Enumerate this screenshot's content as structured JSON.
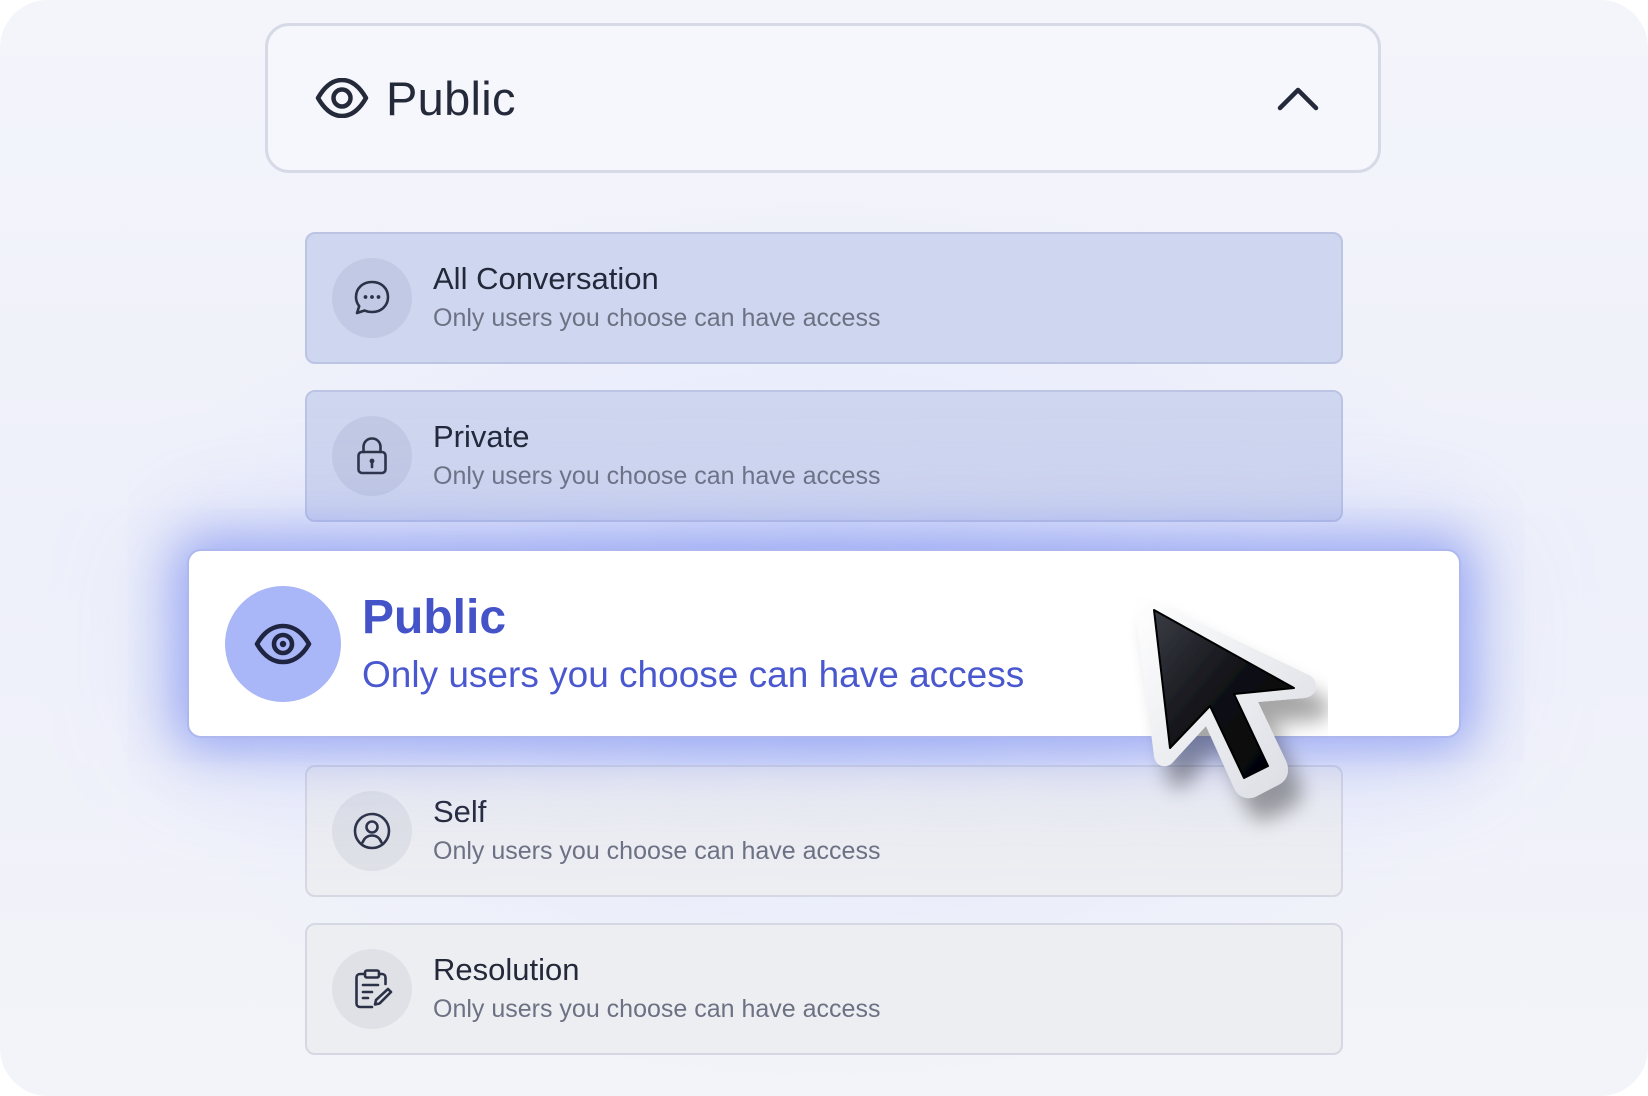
{
  "dropdown": {
    "selected_label": "Public",
    "selected_icon": "eye-icon",
    "toggle_icon": "chevron-up-icon",
    "expanded": true
  },
  "options": [
    {
      "title": "All Conversation",
      "subtitle": "Only users you choose can have access",
      "icon": "chat-bubble-icon"
    },
    {
      "title": "Private",
      "subtitle": "Only users you choose can have access",
      "icon": "lock-icon"
    },
    {
      "title": "Public",
      "subtitle": "Only users you choose can have access",
      "icon": "eye-icon",
      "highlighted": true
    },
    {
      "title": "Self",
      "subtitle": "Only users you choose can have access",
      "icon": "user-circle-icon"
    },
    {
      "title": "Resolution",
      "subtitle": "Only users you choose can have access",
      "icon": "clipboard-edit-icon"
    }
  ],
  "colors": {
    "accent": "#4553c9",
    "accent_soft": "#a9b6f7",
    "glow": "#6c80ee",
    "tinted_option": "#cfd6ef",
    "plain_option": "#edeef2"
  },
  "cursor": {
    "icon": "mouse-pointer-icon"
  }
}
